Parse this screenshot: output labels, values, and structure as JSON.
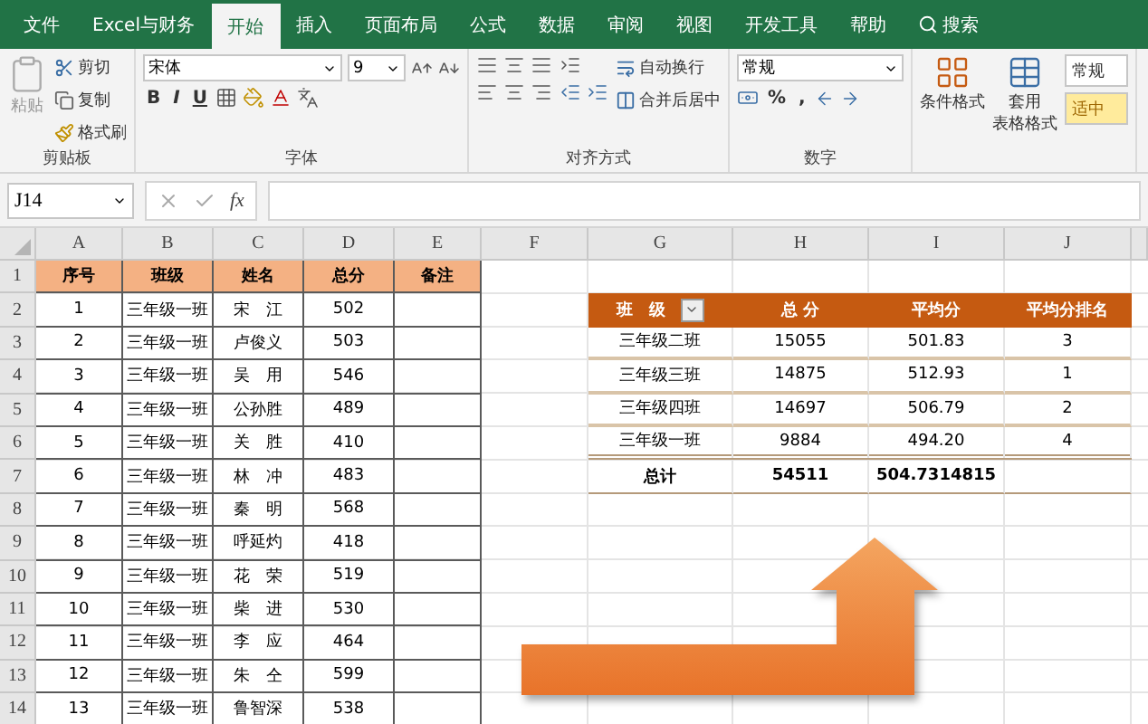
{
  "tabs": [
    {
      "label": "文件",
      "selected": false
    },
    {
      "label": "Excel与财务",
      "selected": false
    },
    {
      "label": "开始",
      "selected": true
    },
    {
      "label": "插入",
      "selected": false
    },
    {
      "label": "页面布局",
      "selected": false
    },
    {
      "label": "公式",
      "selected": false
    },
    {
      "label": "数据",
      "selected": false
    },
    {
      "label": "审阅",
      "selected": false
    },
    {
      "label": "视图",
      "selected": false
    },
    {
      "label": "开发工具",
      "selected": false
    },
    {
      "label": "帮助",
      "selected": false
    }
  ],
  "search": {
    "label": "搜索"
  },
  "clipboard": {
    "paste": "粘贴",
    "cut": "剪切",
    "copy": "复制",
    "format_painter": "格式刷",
    "group": "剪贴板"
  },
  "font": {
    "name": "宋体",
    "size": "9",
    "bold": "B",
    "italic": "I",
    "underline": "U",
    "group": "字体"
  },
  "alignment": {
    "wrap": "自动换行",
    "merge": "合并后居中",
    "group": "对齐方式"
  },
  "number": {
    "format": "常规",
    "percent": "%",
    "comma": ",",
    "group": "数字"
  },
  "styles": {
    "conditional": "条件格式",
    "table_format": [
      "套用",
      "表格格式"
    ],
    "cell_styles": [
      "常规",
      "适中"
    ]
  },
  "formula_bar": {
    "name_box": "J14",
    "function_label": "fx"
  },
  "column_headers": [
    "A",
    "B",
    "C",
    "D",
    "E",
    "F",
    "G",
    "H",
    "I",
    "J"
  ],
  "row_headers": [
    "1",
    "2",
    "3",
    "4",
    "5",
    "6",
    "7",
    "8",
    "9",
    "10",
    "11",
    "12",
    "13",
    "14"
  ],
  "source_table": {
    "columns": [
      "序号",
      "班级",
      "姓名",
      "总分",
      "备注"
    ],
    "rows": [
      [
        "1",
        "三年级一班",
        "宋　江",
        "502"
      ],
      [
        "2",
        "三年级一班",
        "卢俊义",
        "503"
      ],
      [
        "3",
        "三年级一班",
        "吴　用",
        "546"
      ],
      [
        "4",
        "三年级一班",
        "公孙胜",
        "489"
      ],
      [
        "5",
        "三年级一班",
        "关　胜",
        "410"
      ],
      [
        "6",
        "三年级一班",
        "林　冲",
        "483"
      ],
      [
        "7",
        "三年级一班",
        "秦　明",
        "568"
      ],
      [
        "8",
        "三年级一班",
        "呼延灼",
        "418"
      ],
      [
        "9",
        "三年级一班",
        "花　荣",
        "519"
      ],
      [
        "10",
        "三年级一班",
        "柴　进",
        "530"
      ],
      [
        "11",
        "三年级一班",
        "李　应",
        "464"
      ],
      [
        "12",
        "三年级一班",
        "朱　仝",
        "599"
      ],
      [
        "13",
        "三年级一班",
        "鲁智深",
        "538"
      ]
    ]
  },
  "pivot_table": {
    "columns": [
      "班　级",
      "总 分",
      "平均分",
      "平均分排名"
    ],
    "rows": [
      [
        "三年级二班",
        "15055",
        "501.83",
        "3"
      ],
      [
        "三年级三班",
        "14875",
        "512.93",
        "1"
      ],
      [
        "三年级四班",
        "14697",
        "506.79",
        "2"
      ],
      [
        "三年级一班",
        "9884",
        "494.20",
        "4"
      ]
    ],
    "total": [
      "总计",
      "54511",
      "504.7314815"
    ]
  }
}
